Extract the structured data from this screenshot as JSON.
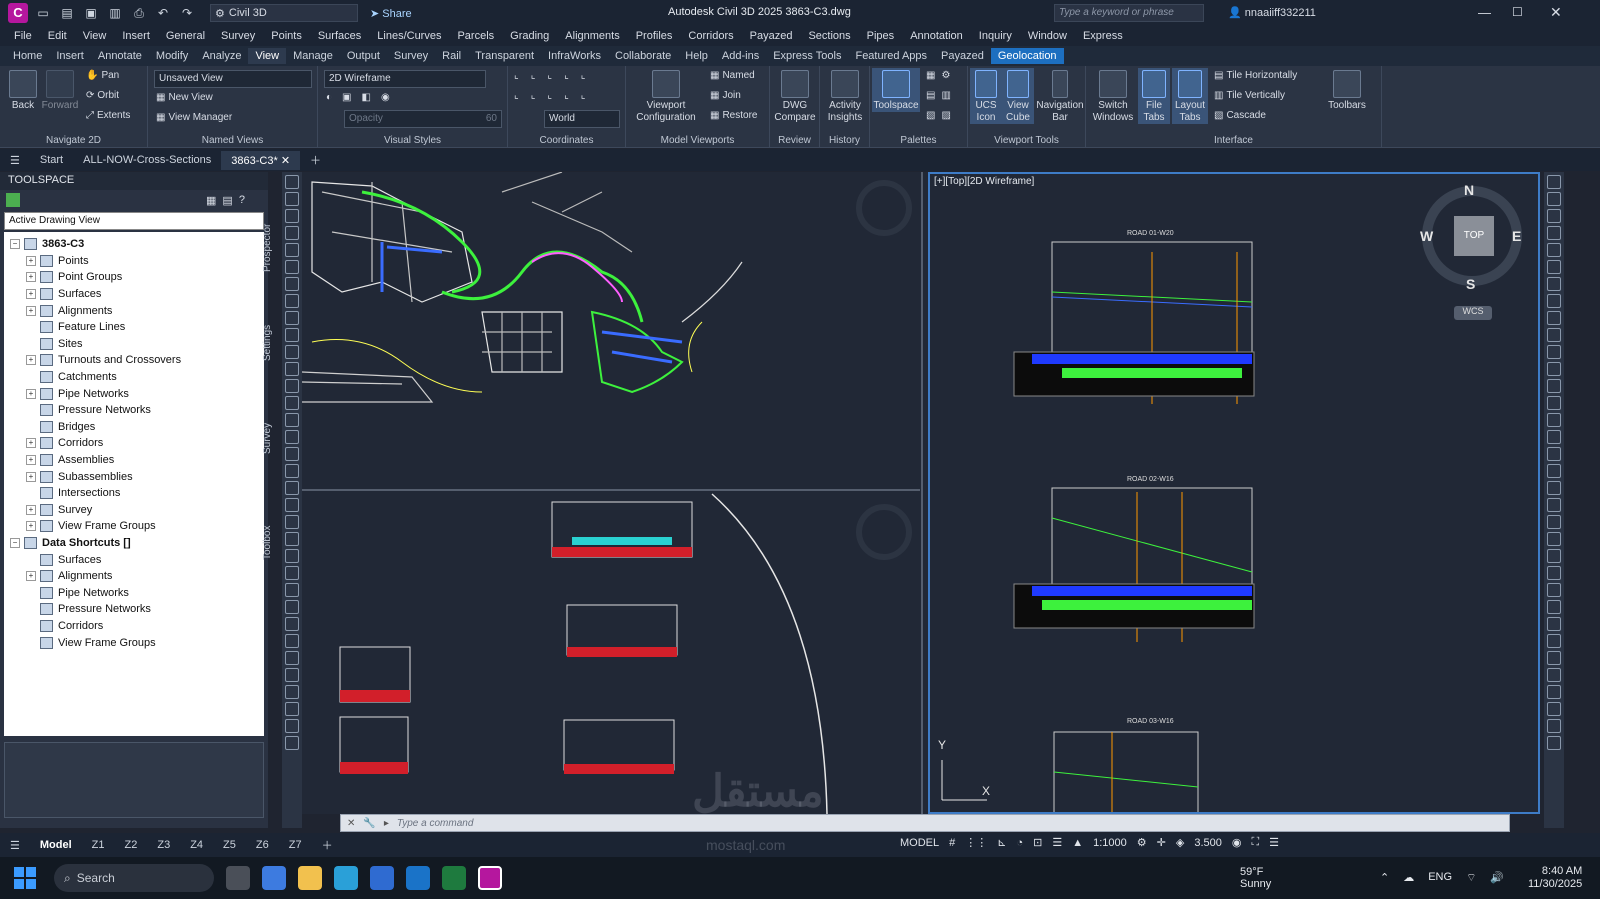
{
  "titlebar": {
    "app_letter": "C",
    "workspace": "Civil 3D",
    "share": "Share",
    "window_title": "Autodesk Civil 3D 2025    3863-C3.dwg",
    "search_placeholder": "Type a keyword or phrase",
    "user": "nnaaiiff332211"
  },
  "menubar": [
    "File",
    "Edit",
    "View",
    "Insert",
    "General",
    "Survey",
    "Points",
    "Surfaces",
    "Lines/Curves",
    "Parcels",
    "Grading",
    "Alignments",
    "Profiles",
    "Corridors",
    "Payazed",
    "Sections",
    "Pipes",
    "Annotation",
    "Inquiry",
    "Window",
    "Express"
  ],
  "ribbon_tabs": [
    "Home",
    "Insert",
    "Annotate",
    "Modify",
    "Analyze",
    "View",
    "Manage",
    "Output",
    "Survey",
    "Rail",
    "Transparent",
    "InfraWorks",
    "Collaborate",
    "Help",
    "Add-ins",
    "Express Tools",
    "Featured Apps",
    "Payazed",
    "Geolocation"
  ],
  "ribbon": {
    "navigate": {
      "title": "Navigate 2D",
      "back": "Back",
      "forward": "Forward",
      "pan": "Pan",
      "orbit": "Orbit",
      "extents": "Extents"
    },
    "named_views": {
      "title": "Named Views",
      "view": "Unsaved View",
      "new_view": "New View",
      "view_manager": "View Manager"
    },
    "visual_styles": {
      "title": "Visual Styles",
      "style": "2D Wireframe",
      "opacity_label": "Opacity",
      "opacity_value": "60"
    },
    "coordinates": {
      "title": "Coordinates",
      "ucs": "World"
    },
    "model_viewports": {
      "title": "Model Viewports",
      "config": "Viewport Configuration",
      "named": "Named",
      "join": "Join",
      "restore": "Restore"
    },
    "review": {
      "title": "Review",
      "dwg_compare": "DWG Compare"
    },
    "history": {
      "title": "History",
      "activity": "Activity Insights"
    },
    "palettes": {
      "title": "Palettes",
      "toolspace": "Toolspace"
    },
    "viewport_tools": {
      "title": "Viewport Tools",
      "ucs_icon": "UCS Icon",
      "view_cube": "View Cube",
      "navigation_bar": "Navigation Bar"
    },
    "interface": {
      "title": "Interface",
      "switch_windows": "Switch Windows",
      "file_tabs": "File Tabs",
      "layout_tabs": "Layout Tabs",
      "tile_h": "Tile Horizontally",
      "tile_v": "Tile Vertically",
      "cascade": "Cascade",
      "toolbars": "Toolbars"
    }
  },
  "file_tabs": [
    "Start",
    "ALL-NOW-Cross-Sections",
    "3863-C3*"
  ],
  "toolspace": {
    "title": "TOOLSPACE",
    "view": "Active Drawing View",
    "side_tabs": [
      "Prospector",
      "Settings",
      "Survey",
      "Toolbox"
    ],
    "tree": [
      {
        "label": "3863-C3",
        "level": 0,
        "exp": "−"
      },
      {
        "label": "Points",
        "level": 1,
        "exp": "+"
      },
      {
        "label": "Point Groups",
        "level": 1,
        "exp": "+"
      },
      {
        "label": "Surfaces",
        "level": 1,
        "exp": "+"
      },
      {
        "label": "Alignments",
        "level": 1,
        "exp": "+"
      },
      {
        "label": "Feature Lines",
        "level": 1,
        "exp": ""
      },
      {
        "label": "Sites",
        "level": 1,
        "exp": ""
      },
      {
        "label": "Turnouts and Crossovers",
        "level": 1,
        "exp": "+"
      },
      {
        "label": "Catchments",
        "level": 1,
        "exp": ""
      },
      {
        "label": "Pipe Networks",
        "level": 1,
        "exp": "+"
      },
      {
        "label": "Pressure Networks",
        "level": 1,
        "exp": ""
      },
      {
        "label": "Bridges",
        "level": 1,
        "exp": ""
      },
      {
        "label": "Corridors",
        "level": 1,
        "exp": "+"
      },
      {
        "label": "Assemblies",
        "level": 1,
        "exp": "+"
      },
      {
        "label": "Subassemblies",
        "level": 1,
        "exp": "+"
      },
      {
        "label": "Intersections",
        "level": 1,
        "exp": ""
      },
      {
        "label": "Survey",
        "level": 1,
        "exp": "+"
      },
      {
        "label": "View Frame Groups",
        "level": 1,
        "exp": "+"
      },
      {
        "label": "Data Shortcuts []",
        "level": 0,
        "exp": "−"
      },
      {
        "label": "Surfaces",
        "level": 1,
        "exp": ""
      },
      {
        "label": "Alignments",
        "level": 1,
        "exp": "+"
      },
      {
        "label": "Pipe Networks",
        "level": 1,
        "exp": ""
      },
      {
        "label": "Pressure Networks",
        "level": 1,
        "exp": ""
      },
      {
        "label": "Corridors",
        "level": 1,
        "exp": ""
      },
      {
        "label": "View Frame Groups",
        "level": 1,
        "exp": ""
      }
    ]
  },
  "viewport": {
    "label": "[+][Top][2D Wireframe]",
    "cube": {
      "n": "N",
      "s": "S",
      "e": "E",
      "w": "W",
      "top": "TOP",
      "wcs": "WCS"
    },
    "ucs_x": "X",
    "ucs_y": "Y"
  },
  "section_titles": [
    "ROAD 01-W20",
    "ROAD 02-W16",
    "ROAD 03-W16"
  ],
  "command": {
    "placeholder": "Type a command"
  },
  "layout_tabs": [
    "Model",
    "Z1",
    "Z2",
    "Z3",
    "Z4",
    "Z5",
    "Z6",
    "Z7"
  ],
  "status": {
    "model": "MODEL",
    "scale": "1:1000",
    "value": "3.500"
  },
  "taskbar": {
    "search": "Search",
    "temp": "59°F",
    "weather": "Sunny",
    "lang": "ENG",
    "time": "8:40 AM",
    "date": "11/30/2025"
  },
  "watermark": {
    "brand": "مستقل",
    "url": "mostaql.com"
  },
  "colors": {
    "accent": "#1d6fc0",
    "app": "#b5179e",
    "viewport_border": "#3e7cc7",
    "canvas": "#212836"
  }
}
